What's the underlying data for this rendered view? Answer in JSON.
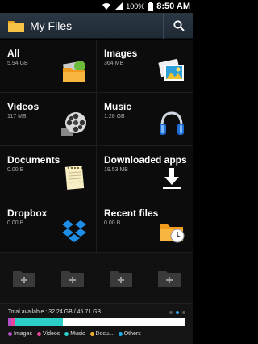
{
  "status_bar": {
    "battery": "100%",
    "time": "8:50 AM"
  },
  "app": {
    "title": "My Files"
  },
  "categories": [
    {
      "label": "All",
      "size": "5.94 GB",
      "icon": "all-files-icon"
    },
    {
      "label": "Images",
      "size": "364 MB",
      "icon": "images-icon"
    },
    {
      "label": "Videos",
      "size": "117 MB",
      "icon": "film-reel-icon"
    },
    {
      "label": "Music",
      "size": "1.28 GB",
      "icon": "headphones-icon"
    },
    {
      "label": "Documents",
      "size": "0.00 B",
      "icon": "notepad-icon"
    },
    {
      "label": "Downloaded apps",
      "size": "19.53 MB",
      "icon": "download-icon"
    },
    {
      "label": "Dropbox",
      "size": "0.00 B",
      "icon": "dropbox-icon"
    },
    {
      "label": "Recent files",
      "size": "0.00 B",
      "icon": "recent-folder-icon"
    }
  ],
  "storage": {
    "total_text": "Total available : 32.24 GB / 45.71 GB",
    "page_dots": 3,
    "active_dot": 1,
    "segments": [
      {
        "name": "Images",
        "color": "#b34fc8",
        "fraction": 0.02
      },
      {
        "name": "Videos",
        "color": "#e8459a",
        "fraction": 0.02
      },
      {
        "name": "Music",
        "color": "#2ccfc7",
        "fraction": 0.27
      },
      {
        "name": "Docu...",
        "color": "#f0b02a",
        "fraction": 0.0
      },
      {
        "name": "Others",
        "color": "#1db0e8",
        "fraction": 0.0
      }
    ],
    "legend": [
      "Images",
      "Videos",
      "Music",
      "Docu...",
      "Others"
    ]
  }
}
